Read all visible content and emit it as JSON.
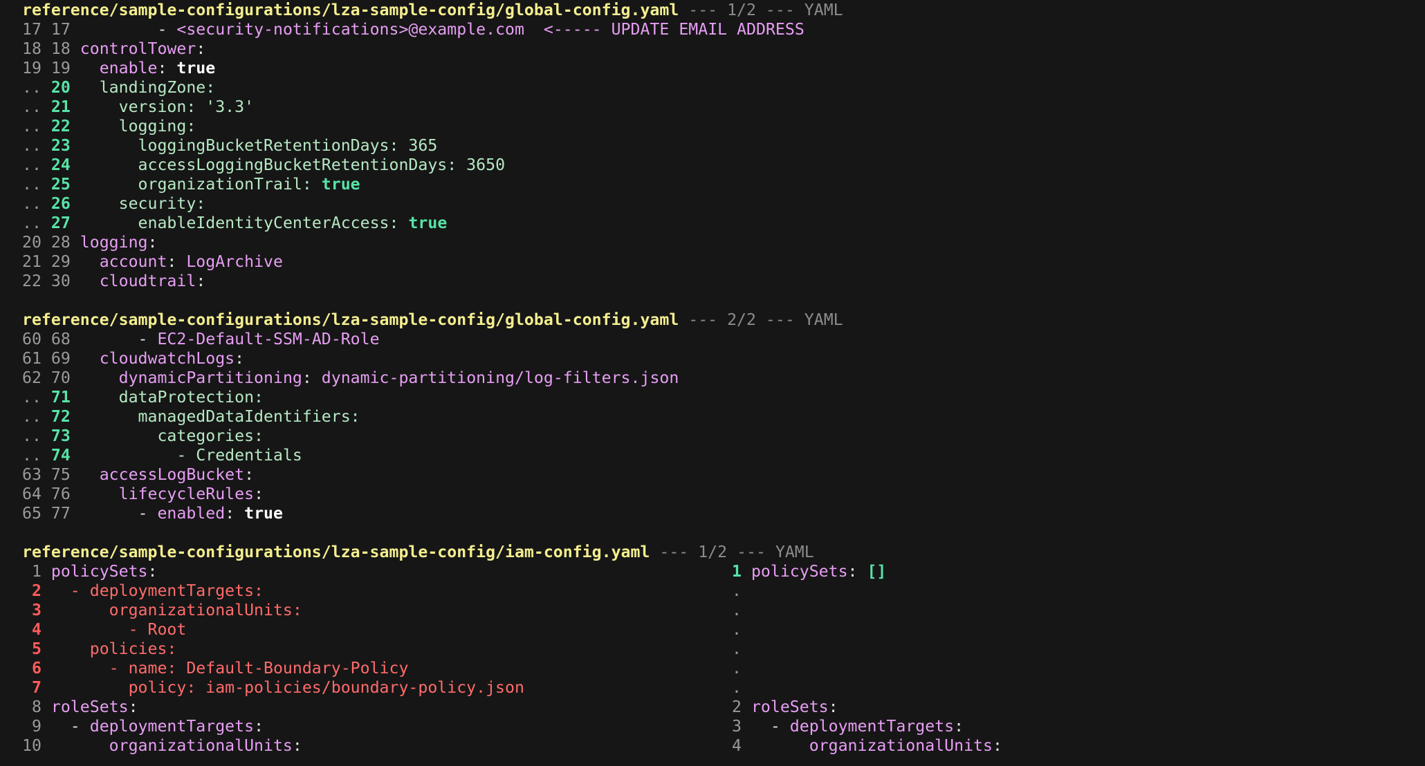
{
  "hunks": [
    {
      "header": {
        "file": "reference/sample-configurations/lza-sample-config/global-config.yaml",
        "meta": " --- 1/2 --- YAML"
      },
      "lines": [
        {
          "ln": "17 17",
          "lncls": "ln",
          "segs": [
            {
              "t": "        - ",
              "c": "p"
            },
            {
              "t": "<security-notifications>@example.com",
              "c": "v"
            },
            {
              "t": "  ",
              "c": "p"
            },
            {
              "t": "<----- UPDATE EMAIL ADDRESS",
              "c": "v"
            }
          ]
        },
        {
          "ln": "18 18",
          "lncls": "ln",
          "segs": [
            {
              "t": "controlTower",
              "c": "k"
            },
            {
              "t": ":",
              "c": "p"
            }
          ]
        },
        {
          "ln": "19 19",
          "lncls": "ln",
          "segs": [
            {
              "t": "  enable",
              "c": "k"
            },
            {
              "t": ": ",
              "c": "p"
            },
            {
              "t": "true",
              "c": "t"
            }
          ]
        },
        {
          "ln": ".. 20",
          "lncls": "mix",
          "segs": [
            {
              "t": "  landingZone:",
              "c": "a"
            }
          ]
        },
        {
          "ln": ".. 21",
          "lncls": "mix",
          "segs": [
            {
              "t": "    version: '3.3'",
              "c": "a"
            }
          ]
        },
        {
          "ln": ".. 22",
          "lncls": "mix",
          "segs": [
            {
              "t": "    logging:",
              "c": "a"
            }
          ]
        },
        {
          "ln": ".. 23",
          "lncls": "mix",
          "segs": [
            {
              "t": "      loggingBucketRetentionDays: 365",
              "c": "a"
            }
          ]
        },
        {
          "ln": ".. 24",
          "lncls": "mix",
          "segs": [
            {
              "t": "      accessLoggingBucketRetentionDays: 3650",
              "c": "a"
            }
          ]
        },
        {
          "ln": ".. 25",
          "lncls": "mix",
          "segs": [
            {
              "t": "      organizationTrail: ",
              "c": "a"
            },
            {
              "t": "true",
              "c": "ab"
            }
          ]
        },
        {
          "ln": ".. 26",
          "lncls": "mix",
          "segs": [
            {
              "t": "    security:",
              "c": "a"
            }
          ]
        },
        {
          "ln": ".. 27",
          "lncls": "mix",
          "segs": [
            {
              "t": "      enableIdentityCenterAccess: ",
              "c": "a"
            },
            {
              "t": "true",
              "c": "ab"
            }
          ]
        },
        {
          "ln": "20 28",
          "lncls": "ln",
          "segs": [
            {
              "t": "logging",
              "c": "k"
            },
            {
              "t": ":",
              "c": "p"
            }
          ]
        },
        {
          "ln": "21 29",
          "lncls": "ln",
          "segs": [
            {
              "t": "  account",
              "c": "k"
            },
            {
              "t": ": ",
              "c": "p"
            },
            {
              "t": "LogArchive",
              "c": "v"
            }
          ]
        },
        {
          "ln": "22 30",
          "lncls": "ln",
          "segs": [
            {
              "t": "  cloudtrail",
              "c": "k"
            },
            {
              "t": ":",
              "c": "p"
            }
          ]
        }
      ]
    },
    {
      "header": {
        "file": "reference/sample-configurations/lza-sample-config/global-config.yaml",
        "meta": " --- 2/2 --- YAML"
      },
      "lines": [
        {
          "ln": "60 68",
          "lncls": "ln",
          "segs": [
            {
              "t": "      - ",
              "c": "p"
            },
            {
              "t": "EC2-Default-SSM-AD-Role",
              "c": "v"
            }
          ]
        },
        {
          "ln": "61 69",
          "lncls": "ln",
          "segs": [
            {
              "t": "  cloudwatchLogs",
              "c": "k"
            },
            {
              "t": ":",
              "c": "p"
            }
          ]
        },
        {
          "ln": "62 70",
          "lncls": "ln",
          "segs": [
            {
              "t": "    dynamicPartitioning",
              "c": "k"
            },
            {
              "t": ": ",
              "c": "p"
            },
            {
              "t": "dynamic-partitioning/log-filters.json",
              "c": "v"
            }
          ]
        },
        {
          "ln": ".. 71",
          "lncls": "mix",
          "segs": [
            {
              "t": "    dataProtection:",
              "c": "a"
            }
          ]
        },
        {
          "ln": ".. 72",
          "lncls": "mix",
          "segs": [
            {
              "t": "      managedDataIdentifiers:",
              "c": "a"
            }
          ]
        },
        {
          "ln": ".. 73",
          "lncls": "mix",
          "segs": [
            {
              "t": "        categories:",
              "c": "a"
            }
          ]
        },
        {
          "ln": ".. 74",
          "lncls": "mix",
          "segs": [
            {
              "t": "          - Credentials",
              "c": "a"
            }
          ]
        },
        {
          "ln": "63 75",
          "lncls": "ln",
          "segs": [
            {
              "t": "  accessLogBucket",
              "c": "k"
            },
            {
              "t": ":",
              "c": "p"
            }
          ]
        },
        {
          "ln": "64 76",
          "lncls": "ln",
          "segs": [
            {
              "t": "    lifecycleRules",
              "c": "k"
            },
            {
              "t": ":",
              "c": "p"
            }
          ]
        },
        {
          "ln": "65 77",
          "lncls": "ln",
          "segs": [
            {
              "t": "      - ",
              "c": "p"
            },
            {
              "t": "enabled",
              "c": "k"
            },
            {
              "t": ": ",
              "c": "p"
            },
            {
              "t": "true",
              "c": "t"
            }
          ]
        }
      ]
    }
  ],
  "split_hunk": {
    "header": {
      "file": "reference/sample-configurations/lza-sample-config/iam-config.yaml",
      "meta": " --- 1/2 --- YAML"
    },
    "rows": [
      {
        "left": {
          "ln": " 1",
          "lncls": "ln",
          "segs": [
            {
              "t": "policySets",
              "c": "k"
            },
            {
              "t": ":",
              "c": "p"
            }
          ]
        },
        "right": {
          "ln": "1",
          "lncls": "ln-add",
          "segs": [
            {
              "t": "policySets",
              "c": "k"
            },
            {
              "t": ": ",
              "c": "p"
            },
            {
              "t": "[]",
              "c": "ab"
            }
          ]
        }
      },
      {
        "left": {
          "ln": " 2",
          "lncls": "ln-del",
          "segs": [
            {
              "t": "  - deploymentTargets:",
              "c": "d"
            }
          ]
        },
        "right": {
          "ln": ".",
          "lncls": "ln-dot",
          "segs": []
        }
      },
      {
        "left": {
          "ln": " 3",
          "lncls": "ln-del",
          "segs": [
            {
              "t": "      organizationalUnits:",
              "c": "d"
            }
          ]
        },
        "right": {
          "ln": ".",
          "lncls": "ln-dot",
          "segs": []
        }
      },
      {
        "left": {
          "ln": " 4",
          "lncls": "ln-del",
          "segs": [
            {
              "t": "        - Root",
              "c": "d"
            }
          ]
        },
        "right": {
          "ln": ".",
          "lncls": "ln-dot",
          "segs": []
        }
      },
      {
        "left": {
          "ln": " 5",
          "lncls": "ln-del",
          "segs": [
            {
              "t": "    policies:",
              "c": "d"
            }
          ]
        },
        "right": {
          "ln": ".",
          "lncls": "ln-dot",
          "segs": []
        }
      },
      {
        "left": {
          "ln": " 6",
          "lncls": "ln-del",
          "segs": [
            {
              "t": "      - name: Default-Boundary-Policy",
              "c": "d"
            }
          ]
        },
        "right": {
          "ln": ".",
          "lncls": "ln-dot",
          "segs": []
        }
      },
      {
        "left": {
          "ln": " 7",
          "lncls": "ln-del",
          "segs": [
            {
              "t": "        policy: iam-policies/boundary-policy.json",
              "c": "d"
            }
          ]
        },
        "right": {
          "ln": ".",
          "lncls": "ln-dot",
          "segs": []
        }
      },
      {
        "left": {
          "ln": " 8",
          "lncls": "ln",
          "segs": [
            {
              "t": "roleSets",
              "c": "k"
            },
            {
              "t": ":",
              "c": "p"
            }
          ]
        },
        "right": {
          "ln": "2",
          "lncls": "ln",
          "segs": [
            {
              "t": "roleSets",
              "c": "k"
            },
            {
              "t": ":",
              "c": "p"
            }
          ]
        }
      },
      {
        "left": {
          "ln": " 9",
          "lncls": "ln",
          "segs": [
            {
              "t": "  - ",
              "c": "p"
            },
            {
              "t": "deploymentTargets",
              "c": "k"
            },
            {
              "t": ":",
              "c": "p"
            }
          ]
        },
        "right": {
          "ln": "3",
          "lncls": "ln",
          "segs": [
            {
              "t": "  - ",
              "c": "p"
            },
            {
              "t": "deploymentTargets",
              "c": "k"
            },
            {
              "t": ":",
              "c": "p"
            }
          ]
        }
      },
      {
        "left": {
          "ln": "10",
          "lncls": "ln",
          "segs": [
            {
              "t": "      ",
              "c": "p"
            },
            {
              "t": "organizationalUnits",
              "c": "k"
            },
            {
              "t": ":",
              "c": "p"
            }
          ]
        },
        "right": {
          "ln": "4",
          "lncls": "ln",
          "segs": [
            {
              "t": "      ",
              "c": "p"
            },
            {
              "t": "organizationalUnits",
              "c": "k"
            },
            {
              "t": ":",
              "c": "p"
            }
          ]
        }
      }
    ]
  }
}
